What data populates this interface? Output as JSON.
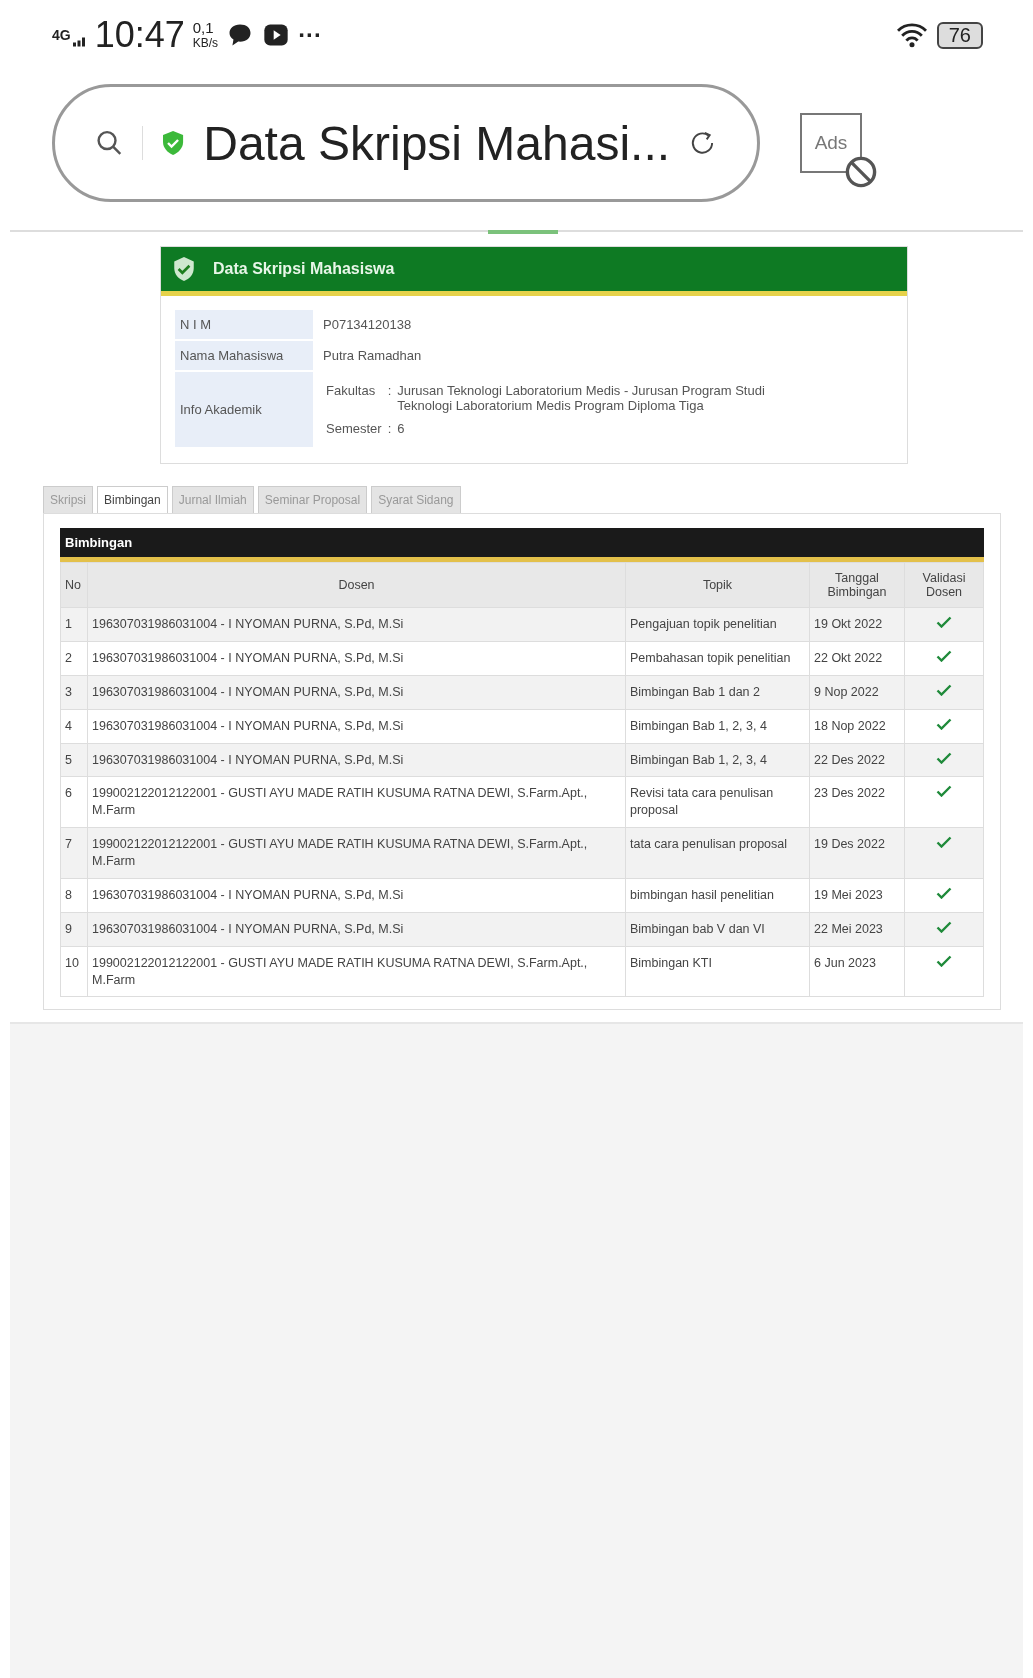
{
  "status_bar": {
    "network": "4G",
    "time": "10:47",
    "speed_value": "0,1",
    "speed_unit": "KB/s",
    "more": "···",
    "battery": "76"
  },
  "browser": {
    "title": "Data Skripsi Mahasi...",
    "ads_label": "Ads"
  },
  "card": {
    "title": "Data Skripsi Mahasiswa",
    "fields": [
      {
        "label": "N I M",
        "value": "P07134120138"
      },
      {
        "label": "Nama Mahasiswa",
        "value": "Putra Ramadhan"
      }
    ],
    "academic": {
      "label": "Info Akademik",
      "items": [
        {
          "label": "Fakultas",
          "separator": ":",
          "value": "Jurusan Teknologi Laboratorium Medis - Jurusan Program Studi Teknologi Laboratorium Medis Program Diploma Tiga"
        },
        {
          "label": "Semester",
          "separator": ":",
          "value": "6"
        }
      ]
    }
  },
  "tabs": [
    {
      "label": "Skripsi",
      "selected": false
    },
    {
      "label": "Bimbingan",
      "selected": true
    },
    {
      "label": "Jurnal Ilmiah",
      "selected": false
    },
    {
      "label": "Seminar Proposal",
      "selected": false
    },
    {
      "label": "Syarat Sidang",
      "selected": false
    }
  ],
  "table": {
    "title": "Bimbingan",
    "columns": [
      "No",
      "Dosen",
      "Topik",
      "Tanggal Bimbingan",
      "Validasi Dosen"
    ],
    "rows": [
      {
        "no": "1",
        "dosen": "196307031986031004 - I NYOMAN PURNA, S.Pd, M.Si",
        "topik": "Pengajuan topik penelitian",
        "tanggal": "19 Okt 2022",
        "validated": true
      },
      {
        "no": "2",
        "dosen": "196307031986031004 - I NYOMAN PURNA, S.Pd, M.Si",
        "topik": "Pembahasan topik penelitian",
        "tanggal": "22 Okt 2022",
        "validated": true
      },
      {
        "no": "3",
        "dosen": "196307031986031004 - I NYOMAN PURNA, S.Pd, M.Si",
        "topik": "Bimbingan Bab 1 dan 2",
        "tanggal": "9 Nop 2022",
        "validated": true
      },
      {
        "no": "4",
        "dosen": "196307031986031004 - I NYOMAN PURNA, S.Pd, M.Si",
        "topik": "Bimbingan Bab 1, 2, 3, 4",
        "tanggal": "18 Nop 2022",
        "validated": true
      },
      {
        "no": "5",
        "dosen": "196307031986031004 - I NYOMAN PURNA, S.Pd, M.Si",
        "topik": "Bimbingan Bab 1, 2, 3, 4",
        "tanggal": "22 Des 2022",
        "validated": true
      },
      {
        "no": "6",
        "dosen": "199002122012122001 - GUSTI AYU MADE RATIH KUSUMA RATNA DEWI, S.Farm.Apt., M.Farm",
        "topik": "Revisi tata cara penulisan proposal",
        "tanggal": "23 Des 2022",
        "validated": true
      },
      {
        "no": "7",
        "dosen": "199002122012122001 - GUSTI AYU MADE RATIH KUSUMA RATNA DEWI, S.Farm.Apt., M.Farm",
        "topik": "tata cara penulisan proposal",
        "tanggal": "19 Des 2022",
        "validated": true
      },
      {
        "no": "8",
        "dosen": "196307031986031004 - I NYOMAN PURNA, S.Pd, M.Si",
        "topik": "bimbingan hasil penelitian",
        "tanggal": "19 Mei 2023",
        "validated": true
      },
      {
        "no": "9",
        "dosen": "196307031986031004 - I NYOMAN PURNA, S.Pd, M.Si",
        "topik": "Bimbingan bab V dan VI",
        "tanggal": "22 Mei 2023",
        "validated": true
      },
      {
        "no": "10",
        "dosen": "199002122012122001 - GUSTI AYU MADE RATIH KUSUMA RATNA DEWI, S.Farm.Apt., M.Farm",
        "topik": "Bimbingan KTI",
        "tanggal": "6 Jun 2023",
        "validated": true
      }
    ]
  }
}
